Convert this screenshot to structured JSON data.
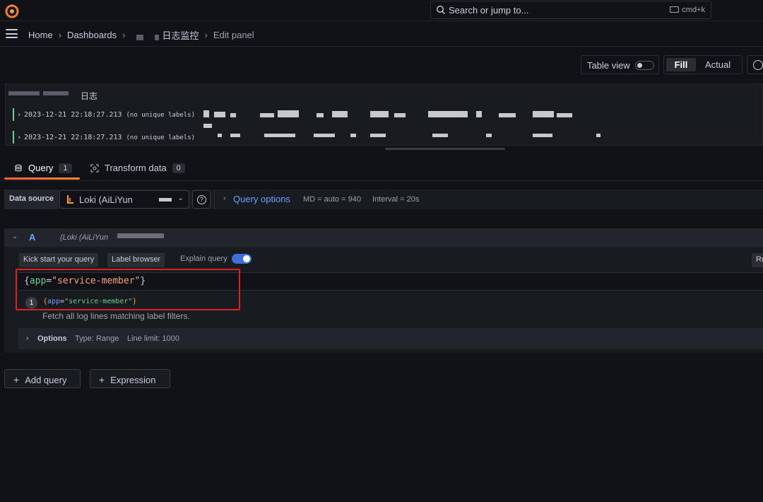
{
  "search": {
    "placeholder": "Search or jump to...",
    "shortcut": "cmd+k"
  },
  "breadcrumb": {
    "home": "Home",
    "dashboards": "Dashboards",
    "dashboard": "日志监控",
    "current": "Edit panel"
  },
  "toolbar": {
    "table_view": "Table view",
    "fill": "Fill",
    "actual": "Actual"
  },
  "panel": {
    "title": "日志",
    "lines": [
      {
        "timestamp": "2023-12-21 22:18:27.213",
        "labels": "(no unique labels)"
      },
      {
        "timestamp": "2023-12-21 22:18:27.213",
        "labels": "(no unique labels)"
      }
    ]
  },
  "tabs": [
    {
      "label": "Query",
      "count": "1"
    },
    {
      "label": "Transform data",
      "count": "0"
    }
  ],
  "datasource": {
    "label": "Data source",
    "name": "Loki (AiLiYun",
    "query_options": "Query options",
    "md": "MD = auto = 940",
    "interval": "Interval = 20s"
  },
  "query": {
    "ref": "A",
    "datasource_name": "(Loki (AiLiYun",
    "kick_start": "Kick start your query",
    "label_browser": "Label browser",
    "explain_query": "Explain query",
    "run": "Ru",
    "expr_open": "{",
    "expr_key": "app",
    "expr_eq": "=",
    "expr_value": "\"service-member\"",
    "expr_close": "}",
    "explain_line_no": "1",
    "explain_desc": "Fetch all log lines matching label filters.",
    "options_title": "Options",
    "options_type": "Type: Range",
    "options_limit": "Line limit: 1000"
  },
  "actions": {
    "add_query": "Add query",
    "expression": "Expression"
  },
  "colors": {
    "accent": "#6e9fff",
    "tab_underline": "#f55f3e",
    "highlight": "#e02020",
    "log_bar": "#6ccf8e"
  }
}
